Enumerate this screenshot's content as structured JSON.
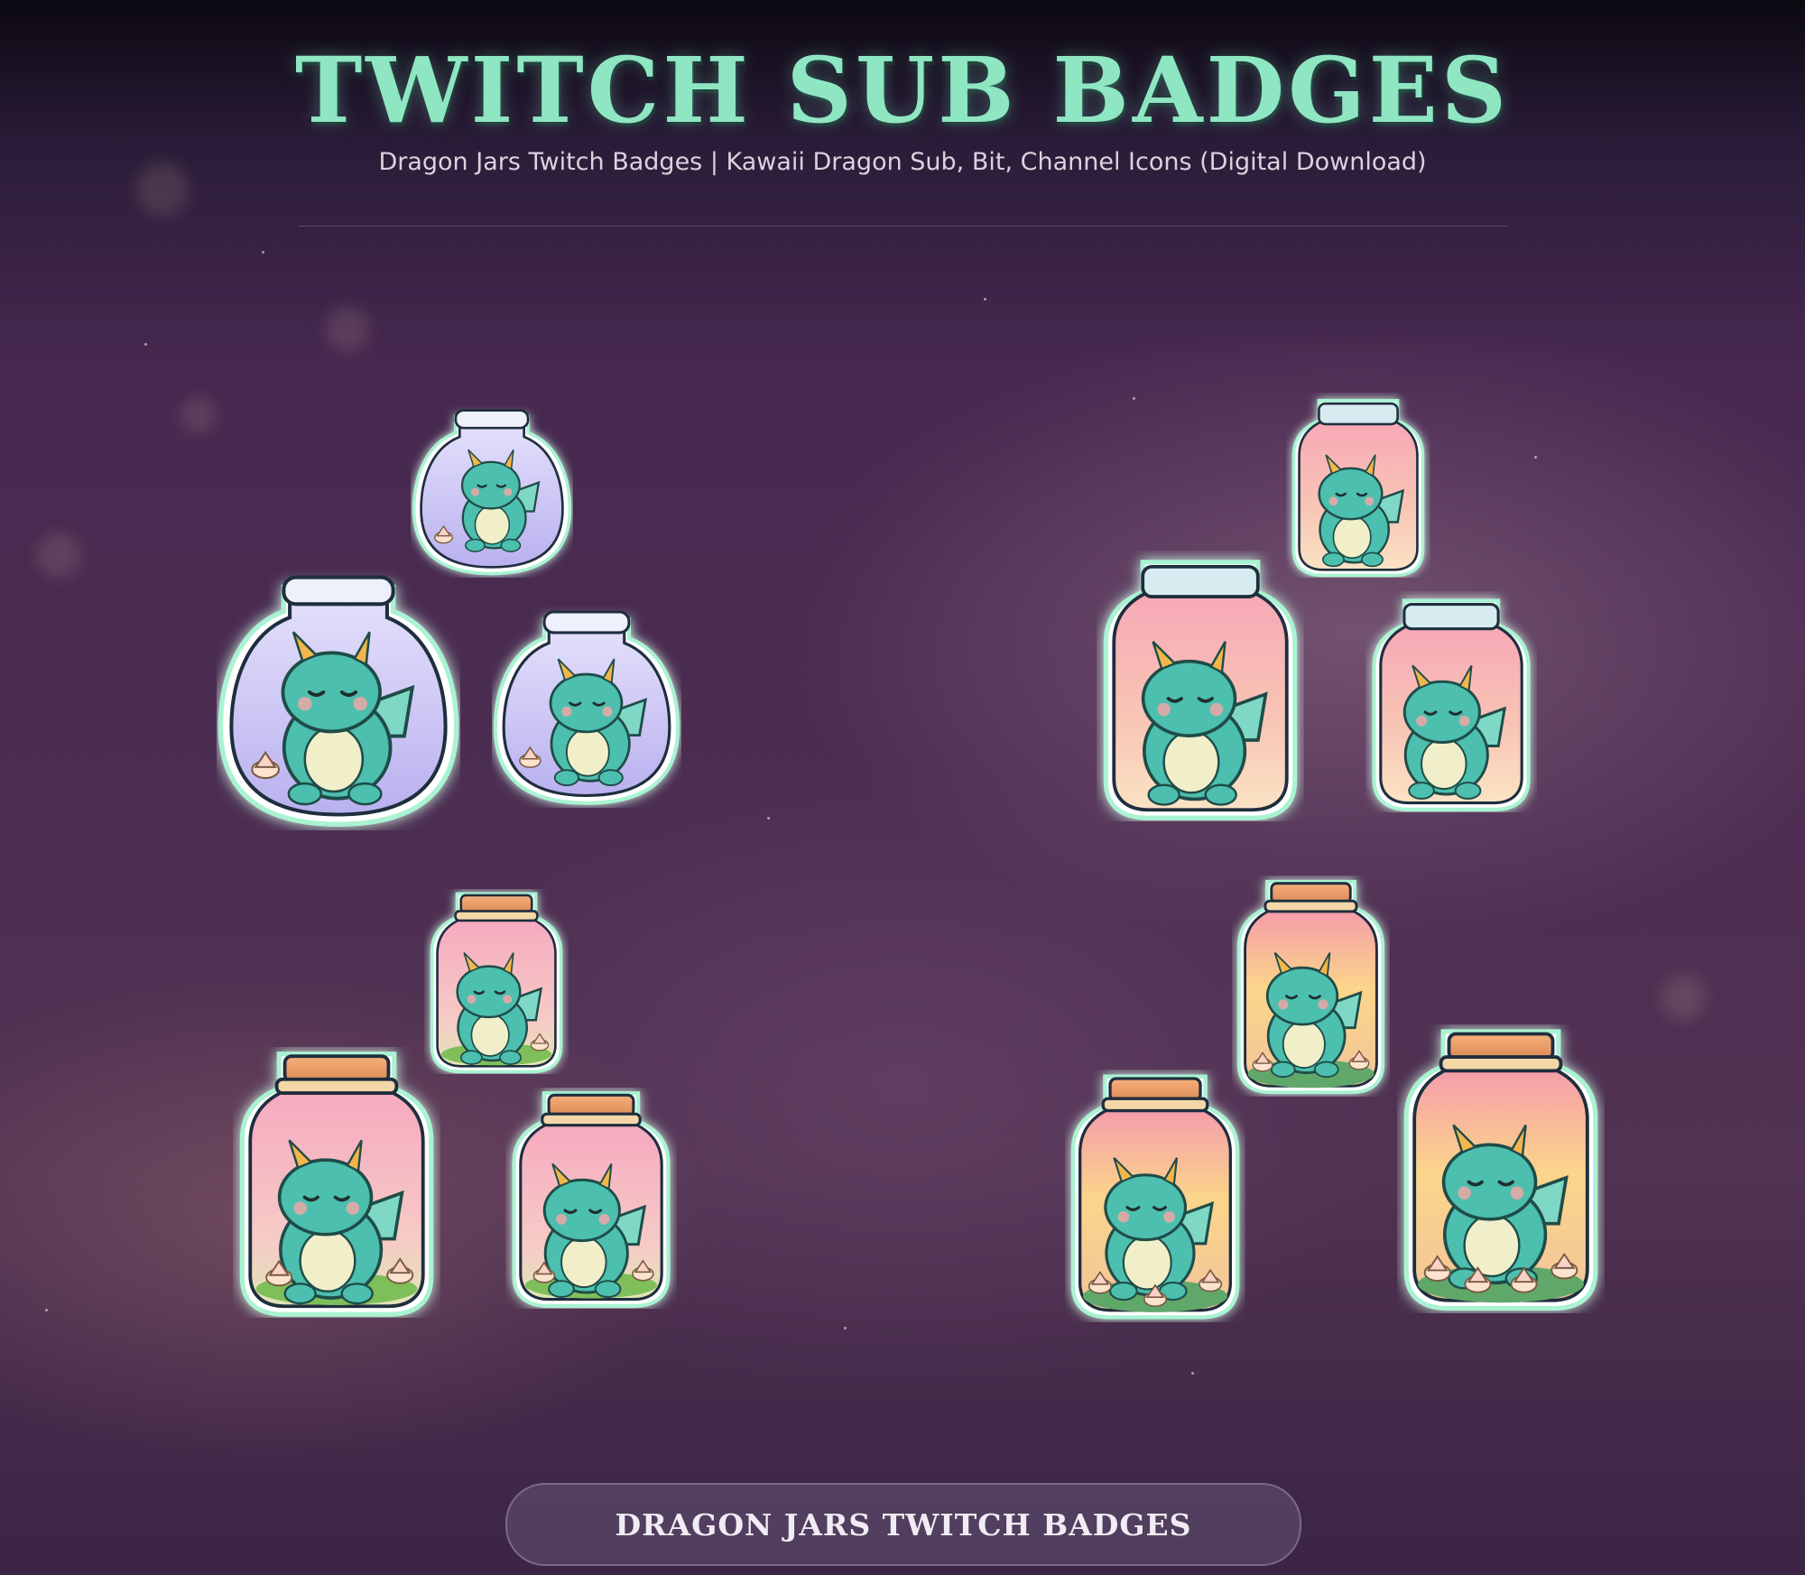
{
  "header": {
    "title": "TWITCH SUB BADGES",
    "subtitle": "Dragon Jars Twitch Badges | Kawaii Dragon Sub, Bit, Channel Icons (Digital Download)"
  },
  "badge_sets": [
    {
      "name": "purple-jar-set",
      "jar_color": "#c9c3f3",
      "lid": "glass"
    },
    {
      "name": "pink-glass-jar-set",
      "jar_color": "#f6b2b6",
      "lid": "glass"
    },
    {
      "name": "pink-cork-jar-set",
      "jar_color": "#f7b4c4",
      "lid": "cork"
    },
    {
      "name": "sunset-cork-jar-set",
      "jar_color": "#f6a79a",
      "lid": "cork"
    }
  ],
  "colors": {
    "title": "#8fe6c2",
    "dragon": "#4cbfae",
    "glow": "#a9f3d3"
  },
  "footer": {
    "button_label": "DRAGON JARS TWITCH BADGES"
  }
}
